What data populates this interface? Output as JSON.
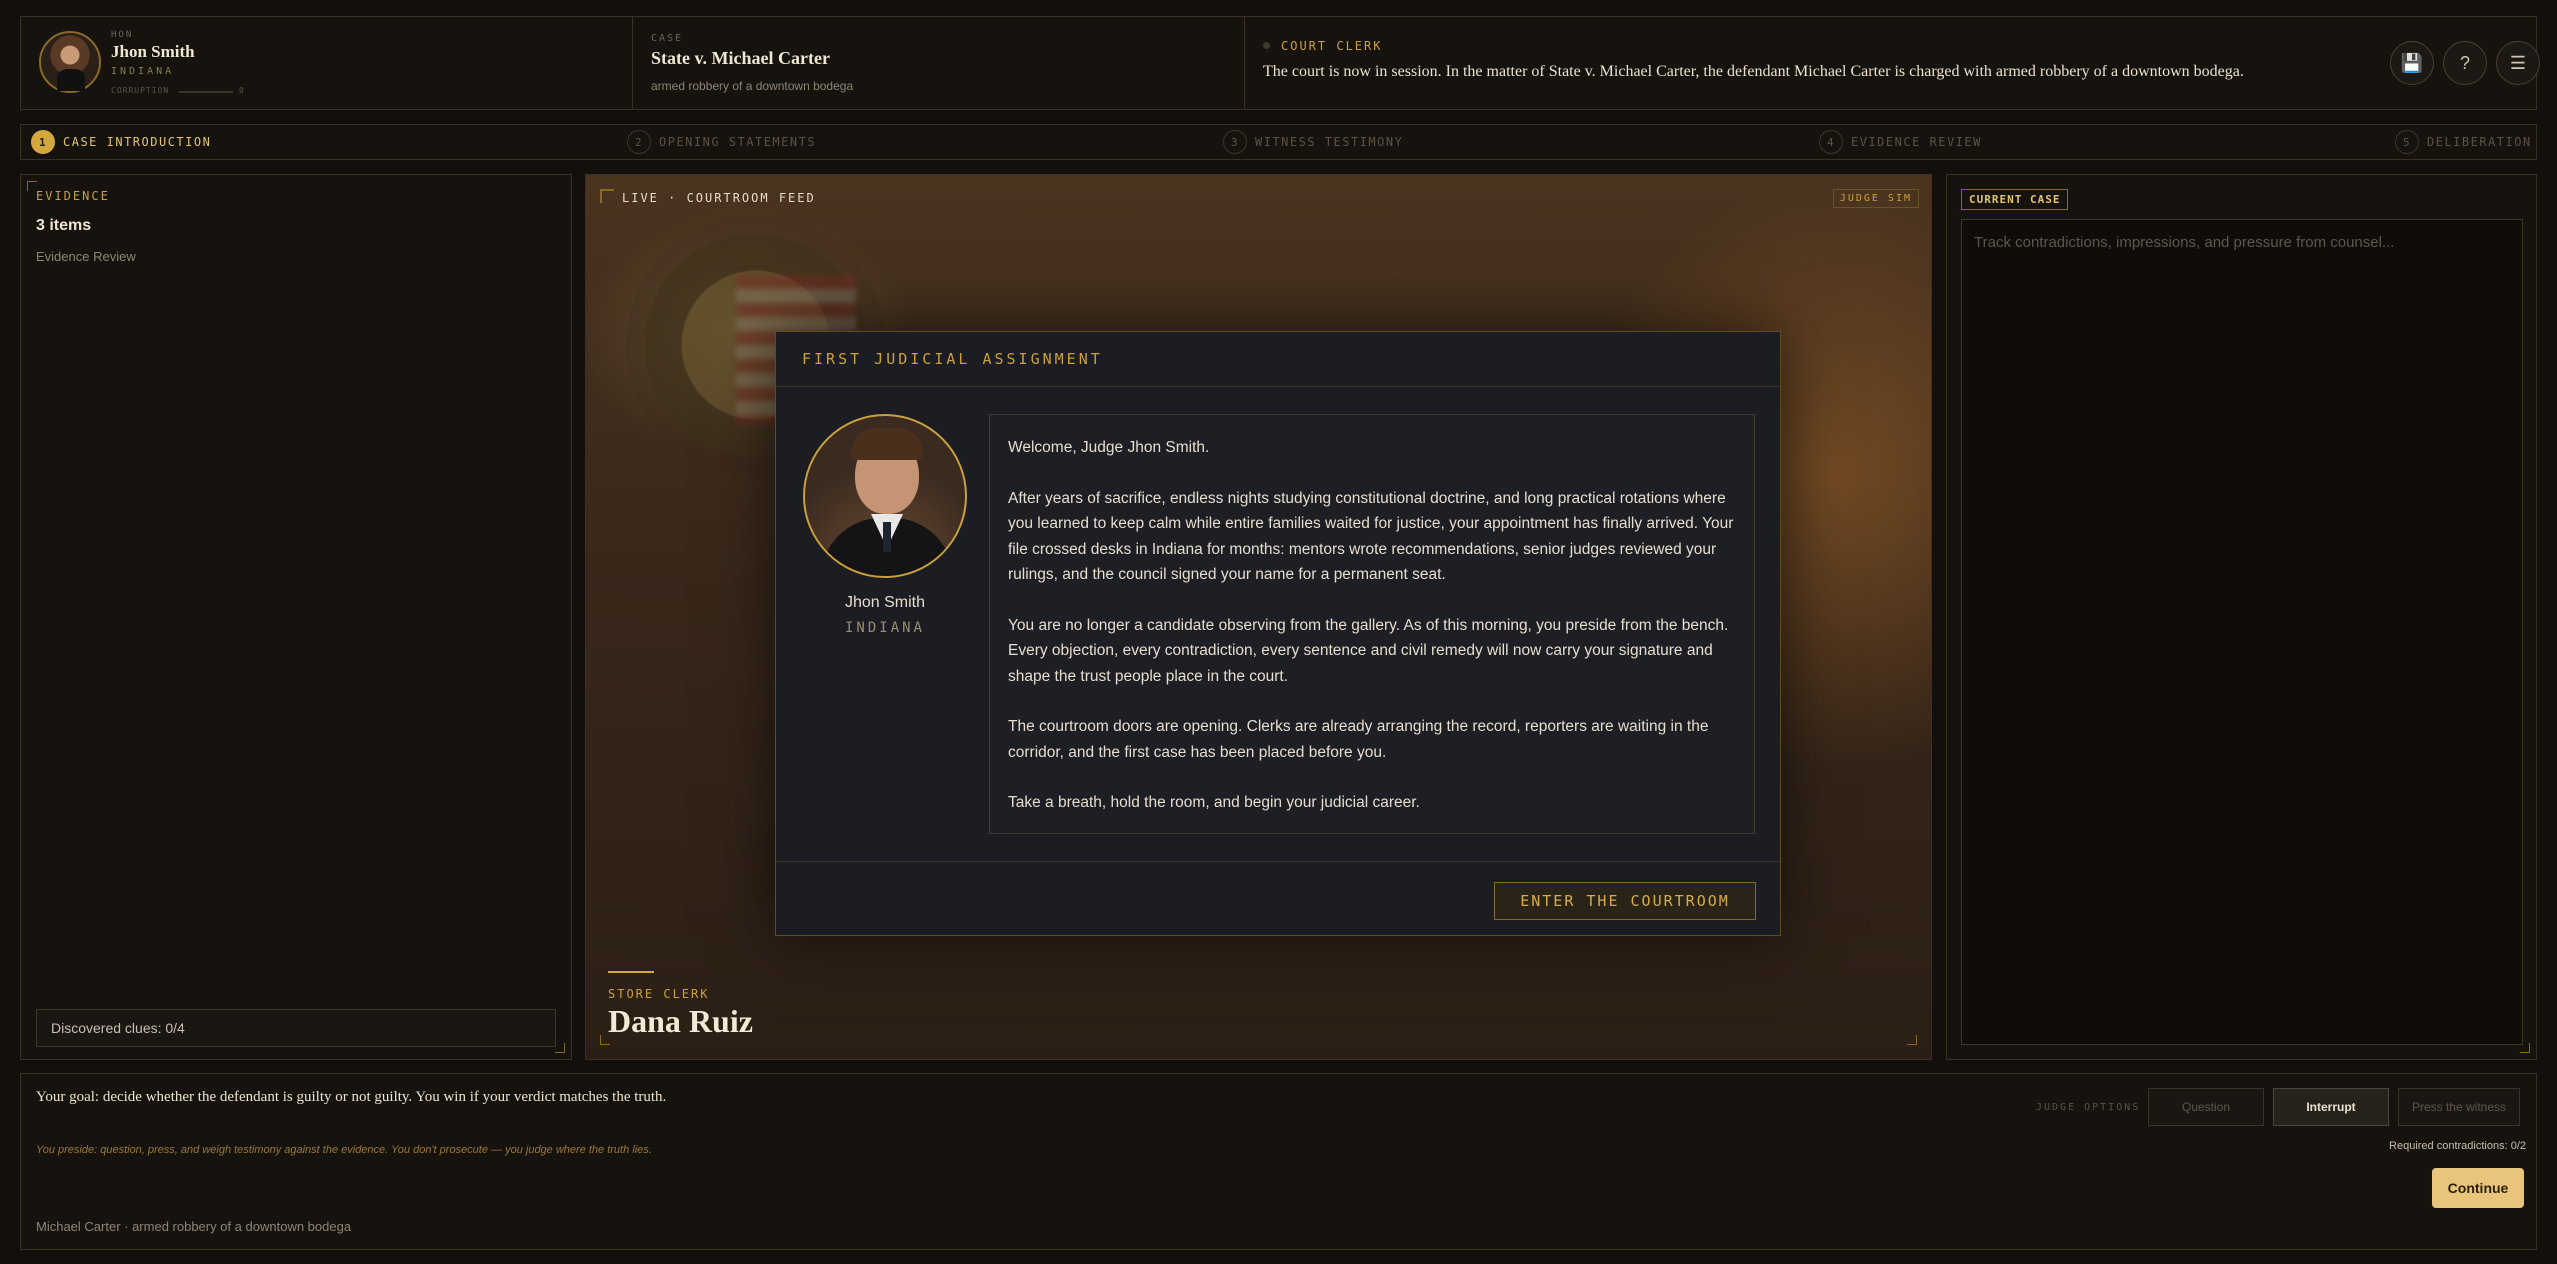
{
  "judge": {
    "title": "HON",
    "name": "Jhon Smith",
    "state": "INDIANA",
    "corruption_label": "CORRUPTION",
    "corruption_value": "0"
  },
  "case": {
    "label": "CASE",
    "title": "State v. Michael Carter",
    "summary": "armed robbery of a downtown bodega"
  },
  "clerk": {
    "label": "COURT CLERK",
    "text": "The court is now in session. In the matter of State v. Michael Carter, the defendant Michael Carter is charged with armed robbery of a downtown bodega."
  },
  "top_buttons": [
    {
      "icon": "save-icon",
      "glyph": "💾"
    },
    {
      "icon": "help-icon",
      "glyph": "?"
    },
    {
      "icon": "menu-icon",
      "glyph": "☰"
    }
  ],
  "steps": [
    {
      "num": "1",
      "label": "CASE INTRODUCTION",
      "active": true
    },
    {
      "num": "2",
      "label": "OPENING STATEMENTS",
      "active": false
    },
    {
      "num": "3",
      "label": "WITNESS TESTIMONY",
      "active": false
    },
    {
      "num": "4",
      "label": "EVIDENCE REVIEW",
      "active": false
    },
    {
      "num": "5",
      "label": "DELIBERATION",
      "active": false
    }
  ],
  "evidence": {
    "heading": "EVIDENCE",
    "count": "3 items",
    "link": "Evidence Review",
    "clues": "Discovered clues: 0/4"
  },
  "court": {
    "feed": "LIVE · COURTROOM FEED",
    "badge": "JUDGE SIM",
    "witness_role": "STORE CLERK",
    "witness_name": "Dana Ruiz"
  },
  "modal": {
    "heading": "FIRST JUDICIAL ASSIGNMENT",
    "name": "Jhon Smith",
    "state": "INDIANA",
    "paragraphs": [
      "Welcome, Judge Jhon Smith.",
      "After years of sacrifice, endless nights studying constitutional doctrine, and long practical rotations where you learned to keep calm while entire families waited for justice, your appointment has finally arrived. Your file crossed desks in Indiana for months: mentors wrote recommendations, senior judges reviewed your rulings, and the council signed your name for a permanent seat.",
      "You are no longer a candidate observing from the gallery. As of this morning, you preside from the bench. Every objection, every contradiction, every sentence and civil remedy will now carry your signature and shape the trust people place in the court.",
      "The courtroom doors are opening. Clerks are already arranging the record, reporters are waiting in the corridor, and the first case has been placed before you.",
      "Take a breath, hold the room, and begin your judicial career."
    ],
    "button": "ENTER THE COURTROOM"
  },
  "current_case": {
    "tag": "CURRENT CASE",
    "placeholder": "Track contradictions, impressions, and pressure from counsel..."
  },
  "bottom": {
    "goal": "Your goal: decide whether the defendant is guilty or not guilty. You win if your verdict matches the truth.",
    "note": "You preside: question, press, and weigh testimony against the evidence. You don't prosecute — you judge where the truth lies.",
    "case_line": "Michael Carter · armed robbery of a downtown bodega",
    "options_label": "JUDGE OPTIONS",
    "options": [
      "Question",
      "Interrupt",
      "Press the witness"
    ],
    "required": "Required contradictions: 0/2",
    "continue": "Continue"
  }
}
